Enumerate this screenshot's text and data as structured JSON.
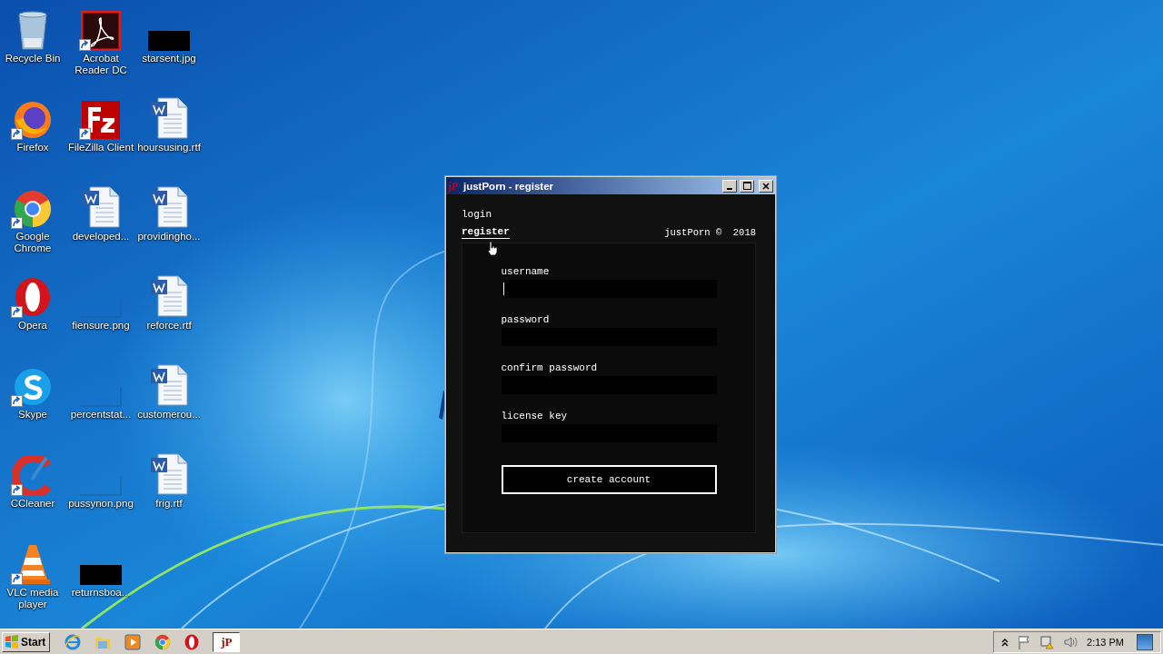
{
  "desktop": {
    "icons": [
      {
        "label": "Recycle Bin",
        "kind": "recycle",
        "shortcut": false
      },
      {
        "label": "Firefox",
        "kind": "firefox",
        "shortcut": true
      },
      {
        "label": "Google Chrome",
        "kind": "chrome",
        "shortcut": true
      },
      {
        "label": "Opera",
        "kind": "opera",
        "shortcut": true
      },
      {
        "label": "Skype",
        "kind": "skype",
        "shortcut": true
      },
      {
        "label": "CCleaner",
        "kind": "ccleaner",
        "shortcut": true
      },
      {
        "label": "VLC media player",
        "kind": "vlc",
        "shortcut": true
      },
      {
        "label": "Acrobat Reader DC",
        "kind": "acrobat",
        "shortcut": true
      },
      {
        "label": "FileZilla Client",
        "kind": "filezilla",
        "shortcut": true
      },
      {
        "label": "developed...",
        "kind": "word",
        "shortcut": false
      },
      {
        "label": "fiensure.png",
        "kind": "blank-image",
        "shortcut": false
      },
      {
        "label": "percentstat...",
        "kind": "blank-image",
        "shortcut": false
      },
      {
        "label": "pussynon.png",
        "kind": "blank-image",
        "shortcut": false
      },
      {
        "label": "returnsboa...",
        "kind": "black-image",
        "shortcut": false
      },
      {
        "label": "starsent.jpg",
        "kind": "black-image",
        "shortcut": false
      },
      {
        "label": "hoursusing.rtf",
        "kind": "word",
        "shortcut": false
      },
      {
        "label": "providingho...",
        "kind": "word",
        "shortcut": false
      },
      {
        "label": "reforce.rtf",
        "kind": "word",
        "shortcut": false
      },
      {
        "label": "customerou...",
        "kind": "word",
        "shortcut": false
      },
      {
        "label": "frig.rtf",
        "kind": "word",
        "shortcut": false
      }
    ]
  },
  "window": {
    "title": "justPorn - register",
    "app_icon_text": "jP",
    "nav": [
      {
        "label": "login",
        "selected": false
      },
      {
        "label": "register",
        "selected": true
      }
    ],
    "copyright": "justPorn ©  2018",
    "fields": [
      {
        "label": "username",
        "focused": true
      },
      {
        "label": "password",
        "focused": false
      },
      {
        "label": "confirm password",
        "focused": false
      },
      {
        "label": "license key",
        "focused": false
      }
    ],
    "submit": "create account"
  },
  "taskbar": {
    "start": "Start",
    "apps": [
      {
        "kind": "ie",
        "active": false
      },
      {
        "kind": "explorer",
        "active": false
      },
      {
        "kind": "media",
        "active": false
      },
      {
        "kind": "chrome",
        "active": false
      },
      {
        "kind": "opera",
        "active": false
      },
      {
        "kind": "app",
        "text": "jP",
        "active": true
      }
    ],
    "clock": "2:13 PM"
  }
}
